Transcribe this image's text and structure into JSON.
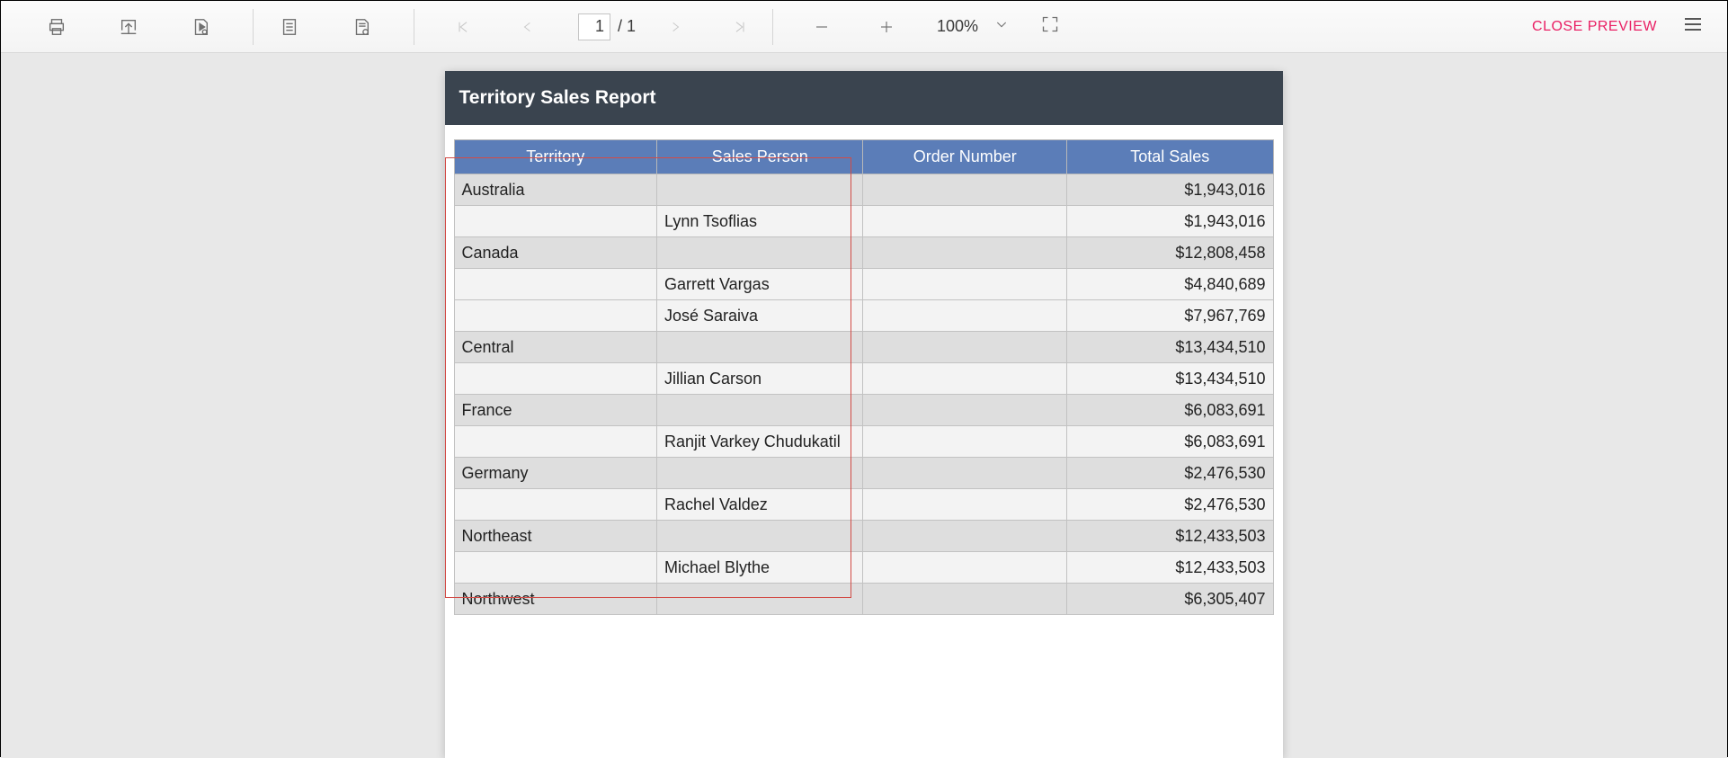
{
  "toolbar": {
    "page_current": "1",
    "page_total": "/ 1",
    "zoom_label": "100%",
    "close_label": "CLOSE PREVIEW"
  },
  "report": {
    "title": "Territory Sales Report",
    "columns": [
      "Territory",
      "Sales Person",
      "Order Number",
      "Total Sales"
    ],
    "rows": [
      {
        "type": "group",
        "territory": "Australia",
        "person": "",
        "order": "",
        "total": "$1,943,016"
      },
      {
        "type": "detail",
        "territory": "",
        "person": "Lynn Tsoflias",
        "order": "",
        "total": "$1,943,016"
      },
      {
        "type": "group",
        "territory": "Canada",
        "person": "",
        "order": "",
        "total": "$12,808,458"
      },
      {
        "type": "detail",
        "territory": "",
        "person": "Garrett Vargas",
        "order": "",
        "total": "$4,840,689"
      },
      {
        "type": "detail",
        "territory": "",
        "person": "José Saraiva",
        "order": "",
        "total": "$7,967,769"
      },
      {
        "type": "group",
        "territory": "Central",
        "person": "",
        "order": "",
        "total": "$13,434,510"
      },
      {
        "type": "detail",
        "territory": "",
        "person": "Jillian Carson",
        "order": "",
        "total": "$13,434,510"
      },
      {
        "type": "group",
        "territory": "France",
        "person": "",
        "order": "",
        "total": "$6,083,691"
      },
      {
        "type": "detail",
        "territory": "",
        "person": "Ranjit Varkey Chudukatil",
        "order": "",
        "total": "$6,083,691"
      },
      {
        "type": "group",
        "territory": "Germany",
        "person": "",
        "order": "",
        "total": "$2,476,530"
      },
      {
        "type": "detail",
        "territory": "",
        "person": "Rachel Valdez",
        "order": "",
        "total": "$2,476,530"
      },
      {
        "type": "group",
        "territory": "Northeast",
        "person": "",
        "order": "",
        "total": "$12,433,503"
      },
      {
        "type": "detail",
        "territory": "",
        "person": "Michael Blythe",
        "order": "",
        "total": "$12,433,503"
      },
      {
        "type": "group",
        "territory": "Northwest",
        "person": "",
        "order": "",
        "total": "$6,305,407"
      }
    ]
  }
}
